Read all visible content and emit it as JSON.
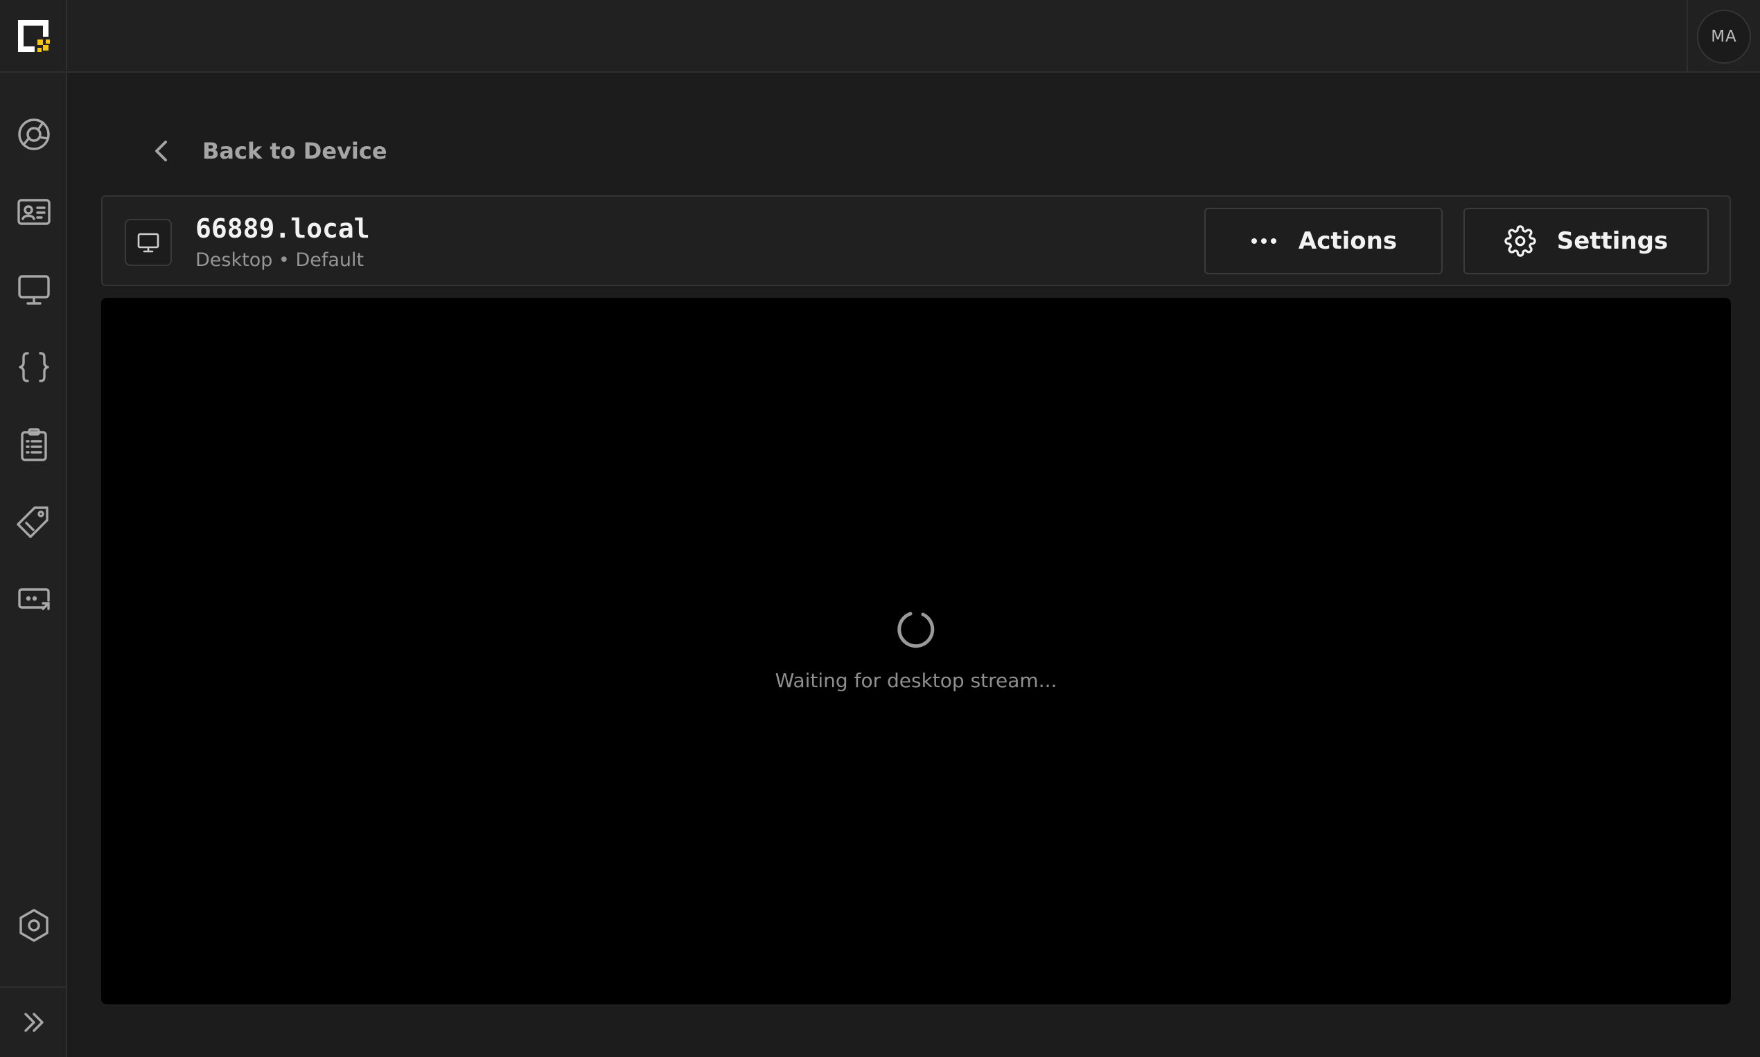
{
  "app": {
    "brand_color": "#f5c518"
  },
  "sidebar": {
    "items": [
      {
        "icon": "dashboard-icon"
      },
      {
        "icon": "contact-card-icon"
      },
      {
        "icon": "monitor-icon"
      },
      {
        "icon": "braces-icon"
      },
      {
        "icon": "clipboard-list-icon"
      },
      {
        "icon": "tag-icon"
      },
      {
        "icon": "remote-session-icon"
      }
    ],
    "bottom_icon": "settings-hex-icon",
    "expand_icon": "chevrons-right-icon"
  },
  "topbar": {
    "avatar_initials": "MA"
  },
  "back": {
    "label": "Back to Device"
  },
  "device": {
    "name": "66889.local",
    "subtitle": "Desktop • Default",
    "actions_label": "Actions",
    "settings_label": "Settings"
  },
  "stream": {
    "status": "Waiting for desktop stream..."
  }
}
